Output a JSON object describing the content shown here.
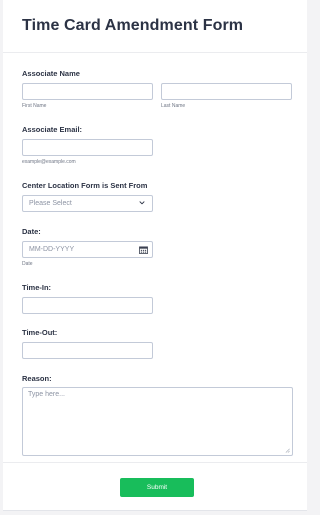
{
  "form": {
    "title": "Time Card Amendment Form",
    "associate_name": {
      "label": "Associate Name",
      "first_sublabel": "First Name",
      "last_sublabel": "Last Name",
      "first_value": "",
      "last_value": ""
    },
    "associate_email": {
      "label": "Associate Email:",
      "sublabel": "example@example.com",
      "value": ""
    },
    "center_location": {
      "label": "Center Location Form is Sent From",
      "selected": "Please Select"
    },
    "date": {
      "label": "Date:",
      "placeholder": "MM-DD-YYYY",
      "sublabel": "Date"
    },
    "time_in": {
      "label": "Time-In:",
      "value": ""
    },
    "time_out": {
      "label": "Time-Out:",
      "value": ""
    },
    "reason": {
      "label": "Reason:",
      "placeholder": "Type here..."
    },
    "submit_label": "Submit"
  },
  "colors": {
    "accent": "#18bd5b",
    "text": "#2c3345",
    "border": "#c3cad8",
    "placeholder": "#8c93a3"
  },
  "icons": {
    "dropdown": "chevron-down-icon",
    "date": "calendar-icon",
    "textarea": "resize-handle-icon"
  }
}
